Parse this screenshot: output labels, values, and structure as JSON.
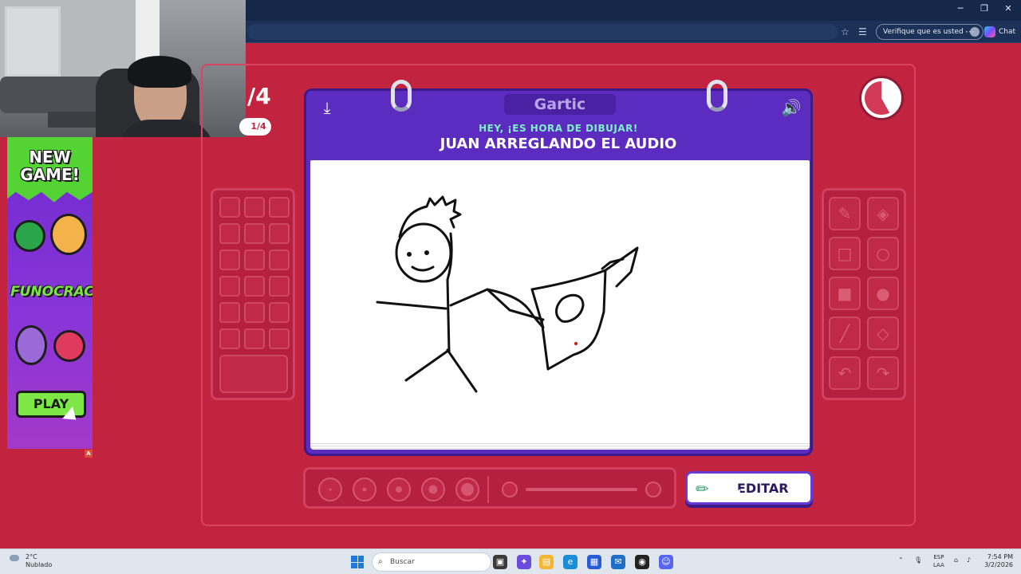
{
  "browser": {
    "verify_label": "Verifique que es usted",
    "chat_label": "Chat",
    "window_controls": [
      "─",
      "❐",
      "✕"
    ]
  },
  "ad": {
    "new_game": "NEW GAME!",
    "brand": "FUNOCRACY",
    "play": "PLAY",
    "badge": "A"
  },
  "round": {
    "big": "/4",
    "pill": "1/4"
  },
  "notebook": {
    "logo": "Gartic",
    "prompt": "HEY, ¡ES HORA DE DIBUJAR!",
    "theme": "JUAN ARREGLANDO EL AUDIO",
    "download_icon": "download-icon",
    "sound_icon": "speaker-icon"
  },
  "timer": {
    "elapsed_fraction": 0.42
  },
  "edit_button": {
    "label": "EDITAR",
    "icon": "pencil-icon"
  },
  "tools": [
    "pencil-icon",
    "eraser-icon",
    "square-outline-icon",
    "circle-outline-icon",
    "square-fill-icon",
    "circle-fill-icon",
    "line-icon",
    "fill-bucket-icon",
    "undo-icon",
    "redo-icon"
  ],
  "taskbar": {
    "temp": "2°C",
    "weather": "Nublado",
    "search_placeholder": "Buscar",
    "lang_top": "ESP",
    "lang_bottom": "LAA",
    "time": "7:54 PM",
    "date": "3/2/2026"
  }
}
